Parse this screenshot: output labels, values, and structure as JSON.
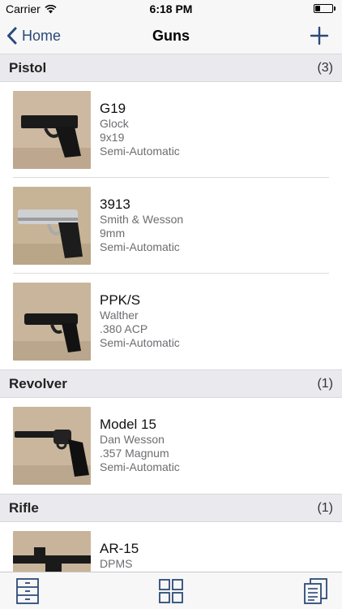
{
  "status_bar": {
    "carrier": "Carrier",
    "time": "6:18 PM",
    "battery_level": 0.3
  },
  "nav": {
    "back_label": "Home",
    "title": "Guns"
  },
  "sections": [
    {
      "title": "Pistol",
      "count": "(3)",
      "items": [
        {
          "name": "G19",
          "maker": "Glock",
          "caliber": "9x19",
          "action": "Semi-Automatic",
          "image": "black-pistol-photo"
        },
        {
          "name": "3913",
          "maker": "Smith & Wesson",
          "caliber": "9mm",
          "action": "Semi-Automatic",
          "image": "silver-pistol-photo"
        },
        {
          "name": "PPK/S",
          "maker": "Walther",
          "caliber": ".380 ACP",
          "action": "Semi-Automatic",
          "image": "small-pistol-photo"
        }
      ]
    },
    {
      "title": "Revolver",
      "count": "(1)",
      "items": [
        {
          "name": "Model 15",
          "maker": "Dan Wesson",
          "caliber": ".357 Magnum",
          "action": "Semi-Automatic",
          "image": "revolver-photo"
        }
      ]
    },
    {
      "title": "Rifle",
      "count": "(1)",
      "items": [
        {
          "name": "AR-15",
          "maker": "DPMS",
          "caliber": "",
          "action": "",
          "image": "rifle-photo"
        }
      ]
    }
  ],
  "tab_bar": [
    "drawers-icon",
    "grid-icon",
    "documents-icon"
  ],
  "colors": {
    "accent": "#2c4a78",
    "section_bg": "#e9e9ee",
    "bar_bg": "#f7f7f7"
  }
}
